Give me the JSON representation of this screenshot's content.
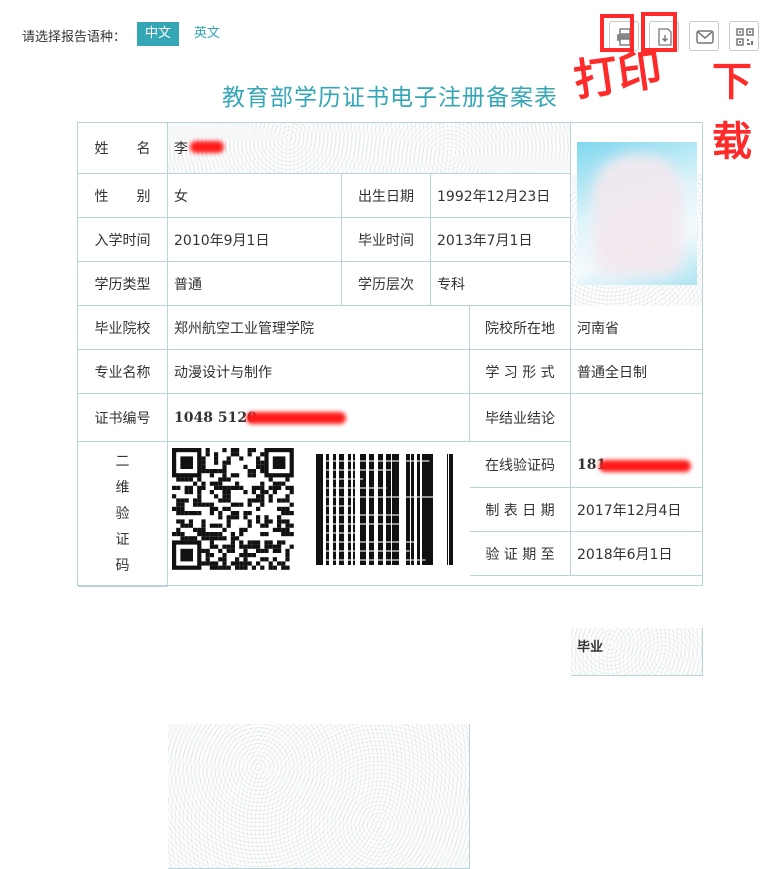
{
  "topbar": {
    "lang_label": "请选择报告语种：",
    "lang_zh": "中文",
    "lang_en": "英文",
    "tools": [
      "print-icon",
      "pdf-download-icon",
      "email-icon",
      "qrcode-icon"
    ]
  },
  "annotations": {
    "print": "打印",
    "download": "下载"
  },
  "title": "教育部学历证书电子注册备案表",
  "fields": {
    "name_label": "姓　　名",
    "name_value": "李",
    "gender_label": "性　　别",
    "gender_value": "女",
    "birth_label": "出生日期",
    "birth_value": "1992年12月23日",
    "enroll_label": "入学时间",
    "enroll_value": "2010年9月1日",
    "grad_label": "毕业时间",
    "grad_value": "2013年7月1日",
    "type_label": "学历类型",
    "type_value": "普通",
    "level_label": "学历层次",
    "level_value": "专科",
    "school_label": "毕业院校",
    "school_value": "郑州航空工业管理学院",
    "location_label": "院校所在地",
    "location_value": "河南省",
    "major_label": "专业名称",
    "major_value": "动漫设计与制作",
    "form_label": "学 习 形 式",
    "form_value": "普通全日制",
    "cert_label": "证书编号",
    "cert_value": "1048 5120",
    "conclusion_label": "毕结业结论",
    "conclusion_value": "毕业",
    "qr_label": "二维验证码",
    "online_code_label": "在线验证码",
    "online_code_value": "181",
    "date_label": "制 表 日 期",
    "date_value": "2017年12月4日",
    "expire_label": "验 证 期 至",
    "expire_value": "2018年6月1日"
  },
  "colors": {
    "accent": "#35a6b6",
    "border": "#b7d4da",
    "redact": "#ff1a1a",
    "scribble": "#ff2a2a"
  }
}
